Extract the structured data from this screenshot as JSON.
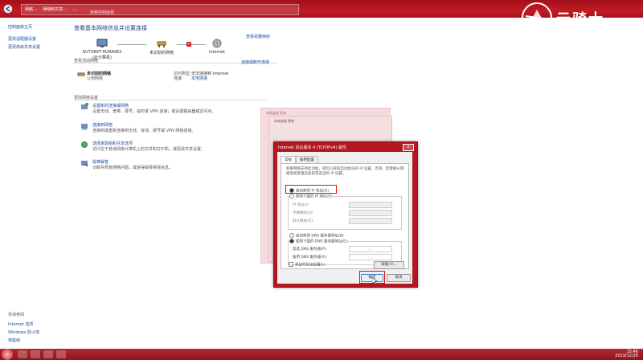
{
  "window": {
    "breadcrumb": [
      "网络...",
      "网络和共享...",
      "..."
    ],
    "search_placeholder": "搜索控制面板"
  },
  "brand": {
    "logo_text": "云骑士"
  },
  "sidebar": {
    "home": "控制面板主页",
    "items": [
      "更改适配器设置",
      "更改高级共享设置"
    ],
    "see_also_title": "另请参阅",
    "see_also": [
      "Internet 选项",
      "Windows 防火墙",
      "家庭组"
    ]
  },
  "main": {
    "title": "查看基本网络信息并设置连接",
    "see_full_map": "查看完整映射",
    "map": {
      "computer_name": "AUTOBVT-M2RA9E2",
      "computer_sub": "(此计算机)",
      "network_label": "未识别的网络",
      "internet_label": "Internet"
    },
    "active_section": "查看活动网络",
    "connect_link": "连接或断开连接",
    "network": {
      "name": "未识别的网络",
      "type": "公用网络",
      "access_key": "访问类型:",
      "access_val": "无法连接到 Internet",
      "conn_key": "连接:",
      "conn_val": "本地连接"
    },
    "change_section": "更改网络设置",
    "tasks": [
      {
        "link": "设置新的连接或网络",
        "desc": "设置无线、宽带、拨号、临时或 VPN 连接；或设置路由器或访问点。"
      },
      {
        "link": "连接到网络",
        "desc": "连接到或重新连接到无线、有线、拨号或 VPN 网络连接。"
      },
      {
        "link": "选择家庭组和共享选项",
        "desc": "访问位于其他网络计算机上的文件和打印机，或更改共享设置。"
      },
      {
        "link": "疑难解答",
        "desc": "诊断并修复网络问题，或获得故障排除信息。"
      }
    ]
  },
  "back_windows": {
    "w1_title": "本地连接 状态",
    "w2_title": "本地连接 属性"
  },
  "dialog": {
    "title": "Internet 协议版本 4 (TCP/IPv4) 属性",
    "close": "x",
    "tabs": [
      "常规",
      "备用配置"
    ],
    "desc": "如果网络支持此功能，则可以获取自动指派的 IP 设置。否则，您需要从网络系统管理员处获得适当的 IP 设置。",
    "auto_ip": "自动获得 IP 地址(O)",
    "manual_ip": "使用下面的 IP 地址(S):",
    "ip_fields": [
      "IP 地址(I):",
      "子网掩码(U):",
      "默认网关(D):"
    ],
    "auto_dns": "自动获得 DNS 服务器地址(B)",
    "manual_dns": "使用下面的 DNS 服务器地址(E):",
    "dns_fields": [
      "首选 DNS 服务器(P):",
      "备用 DNS 服务器(A):"
    ],
    "dns_placeholder": ".      .      .",
    "validate": "退出时验证设置(L)",
    "advanced": "高级(V)...",
    "ok": "确定",
    "cancel": "取消"
  },
  "taskbar": {
    "time": "15:46",
    "date": "2019/12/26"
  },
  "colors": {
    "accent": "#b3171f",
    "link": "#1a4b9b",
    "highlight": "#d11111"
  }
}
